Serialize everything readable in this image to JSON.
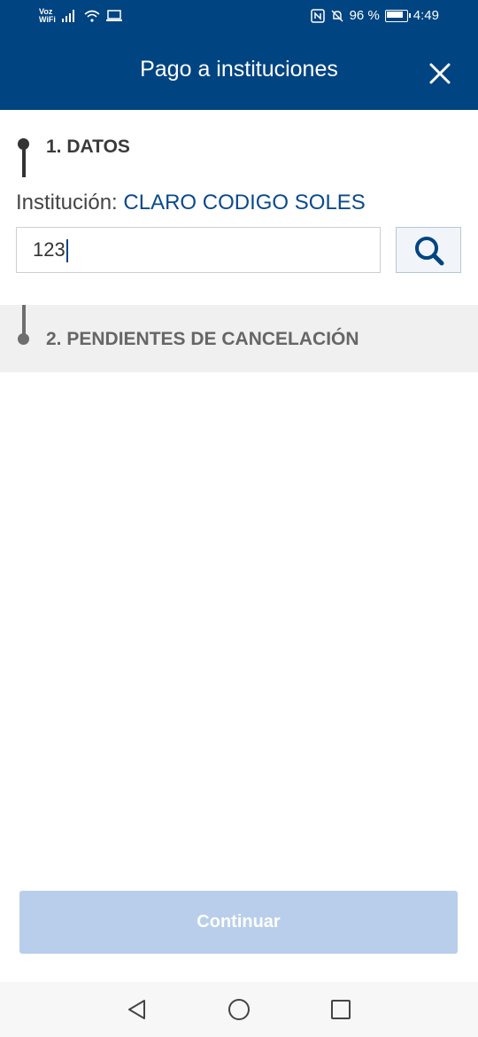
{
  "status_bar": {
    "voz_label": "Voz",
    "wifi_label": "WiFi",
    "battery_percent": "96 %",
    "time": "4:49"
  },
  "header": {
    "title": "Pago a instituciones",
    "close_icon": "close-icon"
  },
  "step1": {
    "title": "1. DATOS",
    "institution_label": "Institución:",
    "institution_value": "CLARO CODIGO SOLES",
    "input_value": "123",
    "search_icon": "search-icon"
  },
  "step2": {
    "title": "2. PENDIENTES DE CANCELACIÓN"
  },
  "footer": {
    "continue_label": "Continuar"
  },
  "nav": {
    "back_icon": "back-triangle-icon",
    "home_icon": "home-circle-icon",
    "recents_icon": "recents-square-icon"
  },
  "colors": {
    "brand": "#004481",
    "institution_value": "#0a4a8a",
    "continue_disabled": "#b8ceea"
  }
}
